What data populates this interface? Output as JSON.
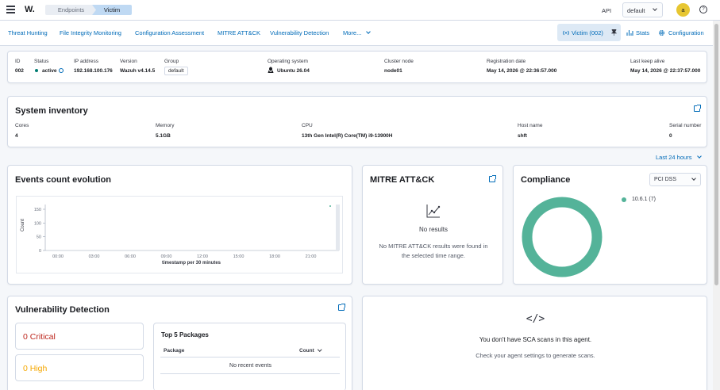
{
  "topbar": {
    "logo": "W.",
    "breadcrumbs": [
      "Endpoints",
      "Victim"
    ],
    "api_label": "API",
    "api_select": "default",
    "avatar": "a",
    "help": "?"
  },
  "tabs": [
    "Threat Hunting",
    "File Integrity Monitoring",
    "Configuration Assessment",
    "MITRE ATT&CK",
    "Vulnerability Detection",
    "More..."
  ],
  "agent_button": "Victim (002)",
  "stats_label": "Stats",
  "configuration_label": "Configuration",
  "agent_info": {
    "labels": [
      "ID",
      "Status",
      "IP address",
      "Version",
      "Group",
      "Operating system",
      "Cluster node",
      "Registration date",
      "Last keep alive"
    ],
    "id": "002",
    "status": "active",
    "ip": "192.168.100.176",
    "version": "Wazuh v4.14.5",
    "group": "default",
    "os": "Ubuntu 26.04",
    "cluster_node": "node01",
    "registration_date": "May 14, 2026 @ 22:36:57.000",
    "last_keep_alive": "May 14, 2026 @ 22:37:57.000"
  },
  "inventory": {
    "title": "System inventory",
    "labels": [
      "Cores",
      "Memory",
      "CPU",
      "Host name",
      "Serial number"
    ],
    "cores": "4",
    "memory": "5.1GB",
    "cpu": "13th Gen Intel(R) Core(TM) i9-13900H",
    "host_name": "shft",
    "serial_number": "0"
  },
  "time_range": "Last 24 hours",
  "events": {
    "title": "Events count evolution",
    "ylabel": "Count",
    "xlabel": "timestamp per 30 minutes"
  },
  "chart_data": {
    "type": "bar",
    "title": "Events count evolution",
    "xlabel": "timestamp per 30 minutes",
    "ylabel": "Count",
    "x_ticks": [
      "00:00",
      "03:00",
      "06:00",
      "09:00",
      "12:00",
      "15:00",
      "18:00",
      "21:00"
    ],
    "y_ticks": [
      "0",
      "50",
      "100",
      "150"
    ],
    "ylim": [
      0,
      150
    ],
    "grid": false,
    "series": [
      {
        "values": [
          0
        ]
      }
    ]
  },
  "mitre": {
    "title": "MITRE ATT&CK",
    "no_results": "No results",
    "message": "No MITRE ATT&CK results were found in the selected time range."
  },
  "compliance": {
    "title": "Compliance",
    "select": "PCI DSS",
    "legend": "10.6.1 (7)",
    "ring_color": "#54b399"
  },
  "vuln": {
    "title": "Vulnerability Detection",
    "critical": "0 Critical",
    "high": "0 High",
    "critical_color": "#bd271e",
    "high_color": "#f5a700",
    "packages_title": "Top 5 Packages",
    "col_package": "Package",
    "col_count": "Count",
    "empty": "No recent events"
  },
  "sca": {
    "code_icon": "</>",
    "line1": "You don't have SCA scans in this agent.",
    "line2": "Check your agent settings to generate scans."
  }
}
